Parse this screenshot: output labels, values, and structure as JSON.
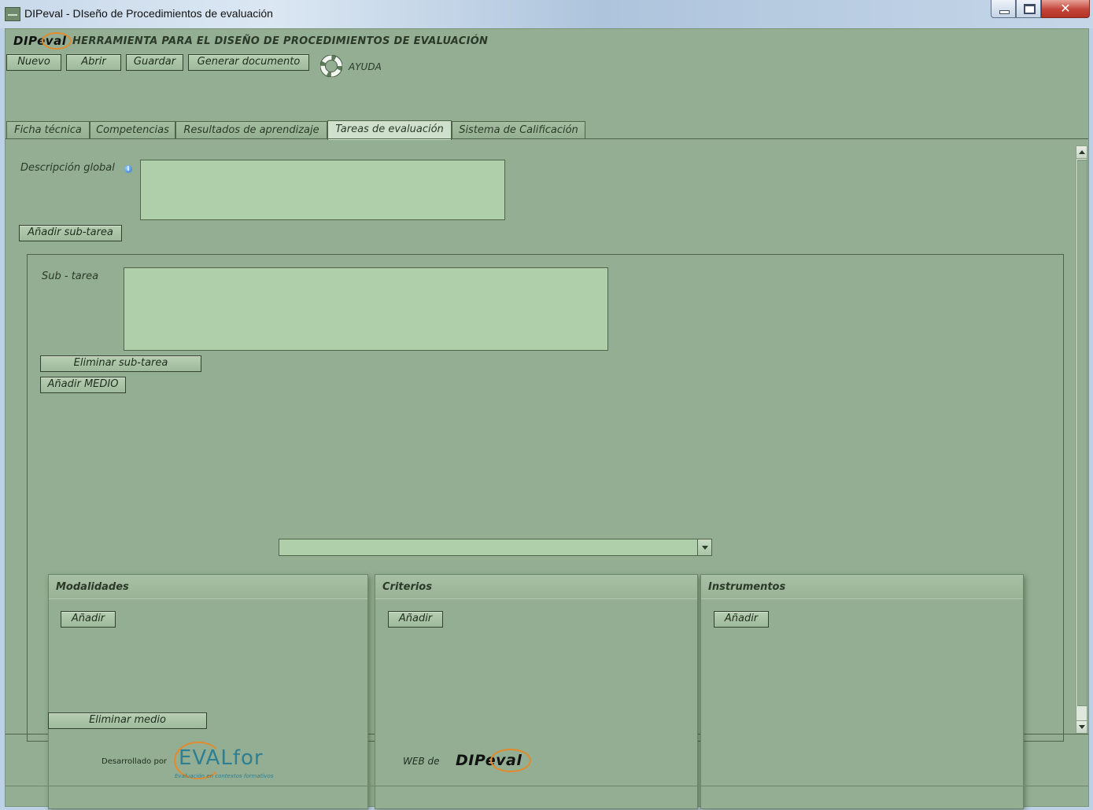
{
  "window": {
    "title": "DIPeval - DIseño de Procedimientos de evaluación",
    "close_glyph": "✕"
  },
  "header": {
    "logo_text": "DIPeval",
    "title": "HERRAMIENTA PARA EL DISEÑO DE PROCEDIMIENTOS DE EVALUACIÓN"
  },
  "toolbar": {
    "nuevo": "Nuevo",
    "abrir": "Abrir",
    "guardar": "Guardar",
    "generar": "Generar documento",
    "ayuda": "AYUDA",
    "help_icon": "lifebuoy-icon"
  },
  "tabs": [
    {
      "label": "Ficha técnica",
      "active": false
    },
    {
      "label": "Competencias",
      "active": false
    },
    {
      "label": "Resultados de aprendizaje",
      "active": false
    },
    {
      "label": "Tareas de evaluación",
      "active": true
    },
    {
      "label": "Sistema de Calificación",
      "active": false
    }
  ],
  "tareas": {
    "descripcion_label": "Descripción global",
    "descripcion_value": "",
    "info_glyph": "i",
    "add_subtask": "Añadir sub-tarea",
    "subtask": {
      "label": "Sub - tarea",
      "value": "",
      "remove": "Eliminar sub-tarea",
      "add_medio": "Añadir MEDIO",
      "medio_selected": "",
      "cards": [
        {
          "title": "Modalidades",
          "add": "Añadir"
        },
        {
          "title": "Criterios",
          "add": "Añadir"
        },
        {
          "title": "Instrumentos",
          "add": "Añadir"
        }
      ],
      "remove_medio": "Eliminar medio"
    }
  },
  "footer": {
    "developed_by": "Desarrollado por",
    "evalfor_text": "EVALfor",
    "evalfor_tagline": "Evaluación en contextos formativos",
    "web_label": "WEB de",
    "logo_text": "DIPeval"
  },
  "colors": {
    "background": "#93ae92",
    "input": "#afcfab",
    "accent": "#e28a2c"
  }
}
